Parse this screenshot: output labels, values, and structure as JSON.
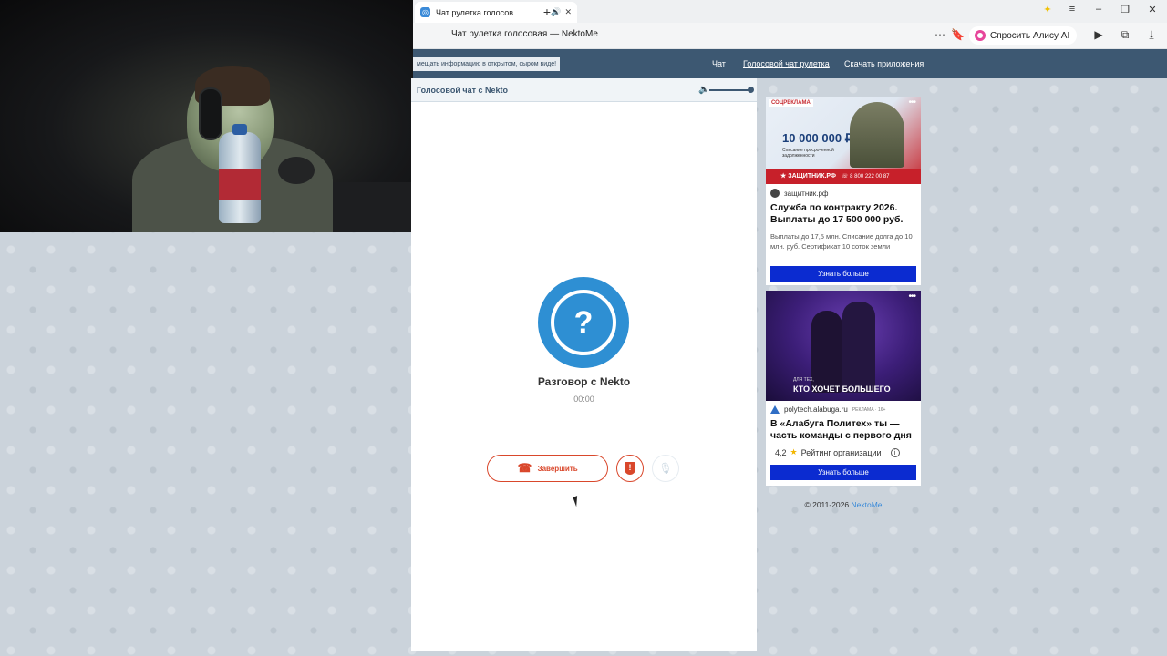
{
  "browser": {
    "tab_title": "Чат рулетка голосов",
    "tab_sound_icon": "speaker-icon",
    "new_tab_label": "+",
    "page_title": "Чат рулетка голосовая — NektoMe",
    "alice_label": "Спросить Алису AI",
    "window_controls": [
      "minimize-icon",
      "maximize-icon",
      "close-icon"
    ]
  },
  "site_nav": {
    "notice": "мещать информацию в открытом, сыром виде!",
    "links": [
      "Чат",
      "Голосовой чат рулетка",
      "Скачать приложения"
    ]
  },
  "chat": {
    "header_title": "Голосовой чат с Nekto",
    "volume_level": 1.0,
    "avatar_glyph": "?",
    "conversation_title": "Разговор с Nekto",
    "timer": "00:00",
    "end_label": "Завершить",
    "report_glyph": "!"
  },
  "ads": [
    {
      "tag": "СОЦРЕКЛАМА",
      "banner_amount": "10 000 000 ₽",
      "banner_sub": "Списание просроченной задолженности",
      "banner_brand": "★ ЗАЩИТНИК.РФ",
      "banner_phone": "☏ 8 800 222 00 87",
      "source": "защитник.рф",
      "headline": "Служба по контракту 2026. Выплаты до 17 500 000 руб.",
      "description": "Выплаты до 17,5 млн. Списание долга до 10 млн. руб. Сертификат 10 соток земли",
      "cta": "Узнать больше"
    },
    {
      "banner_small": "ДЛЯ ТЕХ,",
      "banner_big": "КТО ХОЧЕТ БОЛЬШЕГО",
      "source": "polytech.alabuga.ru",
      "source_tag": "РЕКЛАМА · 16+",
      "headline": "В «Алабуга Политех» ты — часть команды с первого дня",
      "rating_value": "4,2",
      "rating_label": "Рейтинг организации",
      "cta": "Узнать больше"
    }
  ],
  "footer": {
    "copyright": "© 2011-2026",
    "link": "NektoMe"
  }
}
